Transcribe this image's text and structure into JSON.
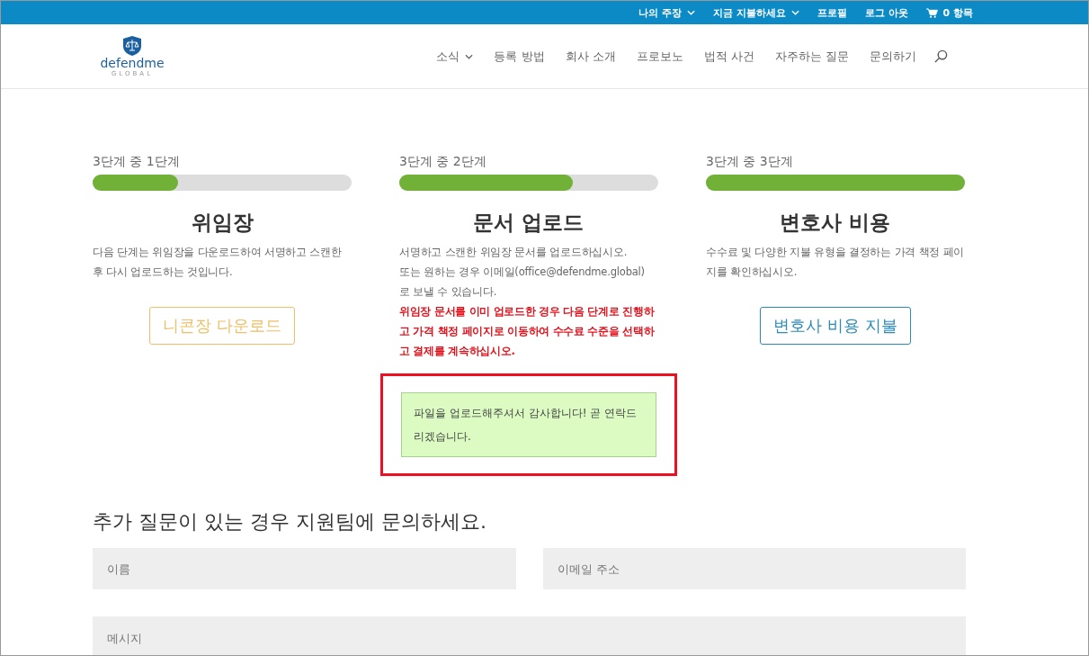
{
  "top_bar": {
    "links": [
      {
        "label": "나의 주장",
        "dropdown": true
      },
      {
        "label": "지금 지불하세요",
        "dropdown": true
      },
      {
        "label": "프로필",
        "dropdown": false
      },
      {
        "label": "로그 아웃",
        "dropdown": false
      }
    ],
    "cart": "0 항목"
  },
  "logo": {
    "name": "defendme",
    "tagline": "GLOBAL"
  },
  "nav": [
    {
      "label": "소식",
      "dropdown": true
    },
    {
      "label": "등록 방법",
      "dropdown": false
    },
    {
      "label": "회사 소개",
      "dropdown": false
    },
    {
      "label": "프로보노",
      "dropdown": false
    },
    {
      "label": "법적 사건",
      "dropdown": false
    },
    {
      "label": "자주하는 질문",
      "dropdown": false
    },
    {
      "label": "문의하기",
      "dropdown": false
    }
  ],
  "steps": [
    {
      "progress_label": "3단계 중 1단계",
      "level": 0.33,
      "title": "위임장",
      "paragraphs": [
        "다음 단계는 위임장을 다운로드하여 서명하고 스캔한 후 다시 업로드하는 것입니다."
      ],
      "button": {
        "label": "니콘장 다운로드",
        "color": "#ecc06a"
      }
    },
    {
      "progress_label": "3단계 중 2단계",
      "level": 0.67,
      "title": "문서 업로드",
      "paragraphs": [
        "서명하고 스캔한 위임장 문서를 업로드하십시오.",
        "또는 원하는 경우 이메일(office@defendme.global) 로 보낼 수 있습니다."
      ],
      "note": "위임장 문서를 이미 업로드한 경우 다음 단계로 진행하고 가격 책정 페이지로 이동하여 수수료 수준을 선택하고 결제를 계속하십시오.",
      "success_message": "파일을 업로드해주셔서 감사합니다! 곧 연락드리겠습니다.",
      "highlighted": true
    },
    {
      "progress_label": "3단계 중 3단계",
      "level": 1,
      "title": "변호사 비용",
      "paragraphs": [
        "수수료 및 다양한 지불 유형을 결정하는 가격 책정 페이지를 확인하십시오."
      ],
      "button": {
        "label": "변호사 비용 지불",
        "color": "#2a8ab8"
      }
    }
  ],
  "contact": {
    "heading": "추가 질문이 있는 경우 지원팀에 문의하세요.",
    "fields": [
      {
        "placeholder": "이름"
      },
      {
        "placeholder": "이메일 주소"
      }
    ],
    "message": {
      "placeholder": "메시지"
    }
  }
}
